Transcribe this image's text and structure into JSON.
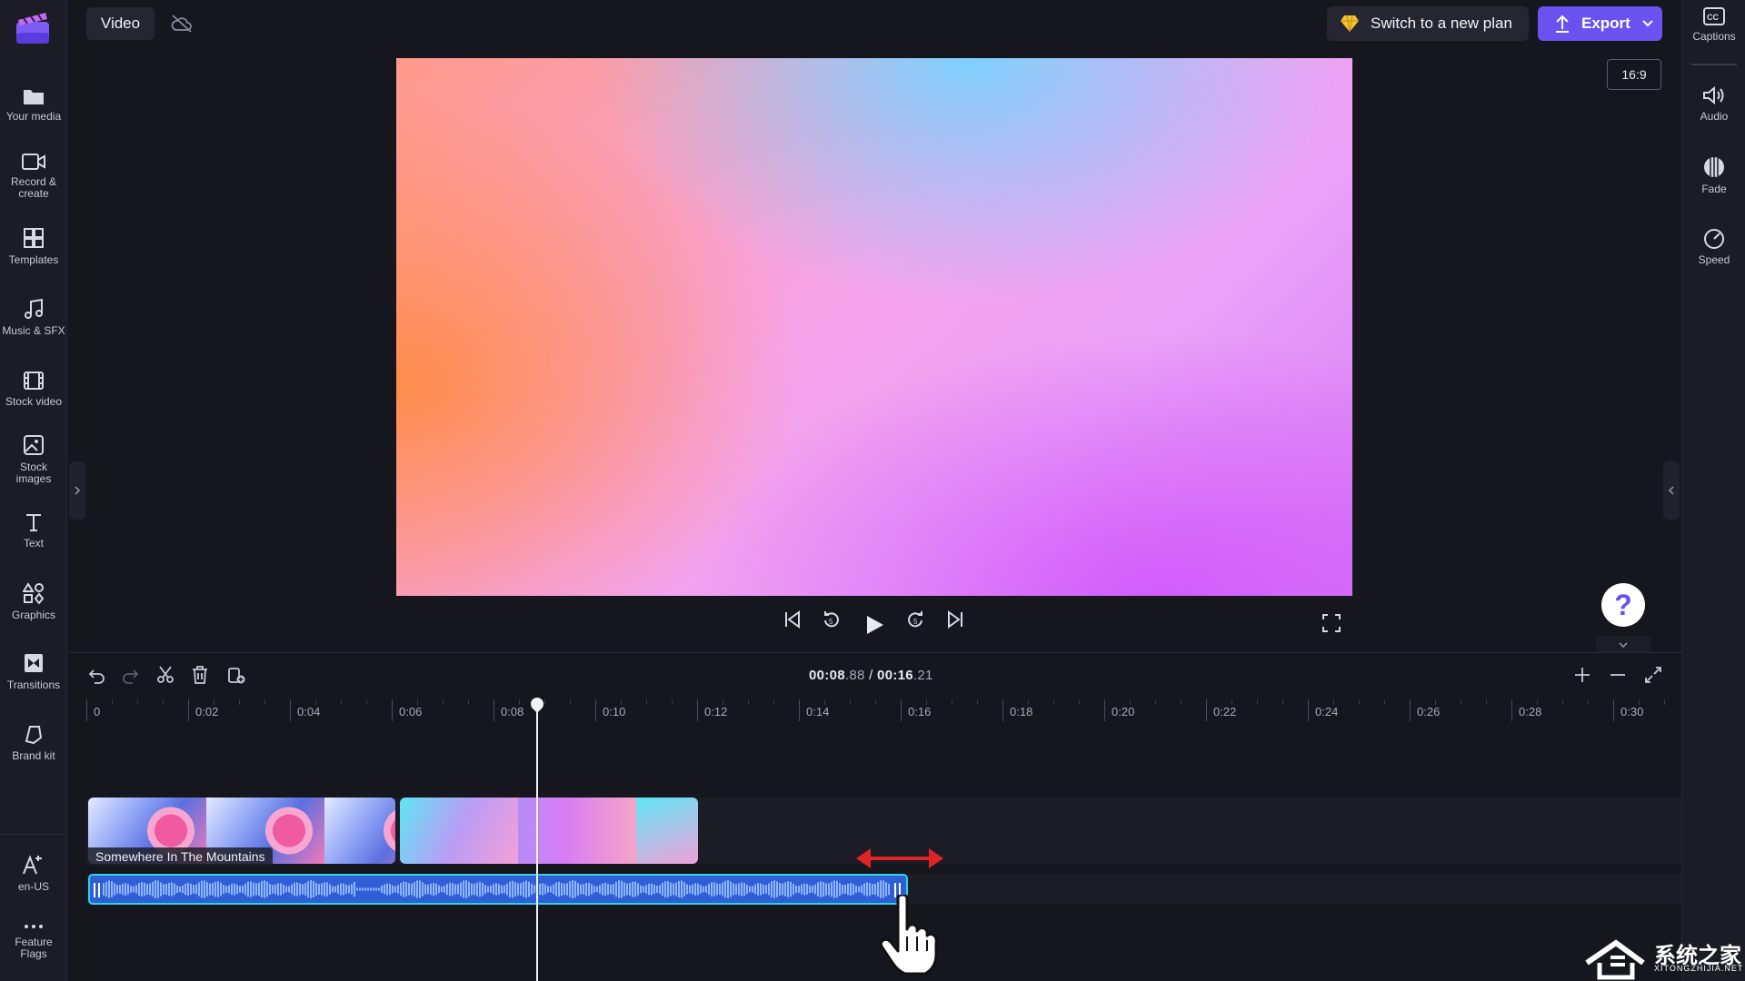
{
  "header": {
    "tab_label": "Video",
    "plan_button": "Switch to a new plan",
    "export_button": "Export",
    "aspect_ratio": "16:9"
  },
  "left_rail": {
    "items": [
      {
        "label": "Your media",
        "icon": "folder-icon"
      },
      {
        "label": "Record &\ncreate",
        "icon": "camera-icon"
      },
      {
        "label": "Templates",
        "icon": "templates-icon"
      },
      {
        "label": "Music & SFX",
        "icon": "music-icon"
      },
      {
        "label": "Stock video",
        "icon": "film-icon"
      },
      {
        "label": "Stock\nimages",
        "icon": "image-icon"
      },
      {
        "label": "Text",
        "icon": "text-icon"
      },
      {
        "label": "Graphics",
        "icon": "shapes-icon"
      },
      {
        "label": "Transitions",
        "icon": "transitions-icon"
      },
      {
        "label": "Brand kit",
        "icon": "brand-kit-icon"
      }
    ],
    "bottom_items": [
      {
        "label": "en-US",
        "icon": "language-icon"
      },
      {
        "label": "Feature\nFlags",
        "icon": "more-icon"
      }
    ]
  },
  "right_rail": {
    "items": [
      {
        "label": "Captions",
        "icon": "captions-icon"
      },
      {
        "label": "Audio",
        "icon": "speaker-icon"
      },
      {
        "label": "Fade",
        "icon": "fade-icon"
      },
      {
        "label": "Speed",
        "icon": "speedometer-icon"
      }
    ]
  },
  "timeline": {
    "current_time_main": "00:08",
    "current_time_frac": ".88",
    "separator": " / ",
    "total_time_main": "00:16",
    "total_time_frac": ".21",
    "ruler_labels": [
      "0",
      "0:02",
      "0:04",
      "0:06",
      "0:08",
      "0:10",
      "0:12",
      "0:14",
      "0:16",
      "0:18",
      "0:20",
      "0:22",
      "0:24",
      "0:26",
      "0:28",
      "0:30"
    ],
    "video_clip_title": "Somewhere In The Mountains"
  },
  "watermark": {
    "text": "系统之家",
    "sub": "XITONGZHIJIA.NET"
  },
  "colors": {
    "accent": "#6b52f0",
    "audio_track": "#2f5fd6",
    "audio_border": "#32d3e0",
    "arrow": "#e02424"
  }
}
